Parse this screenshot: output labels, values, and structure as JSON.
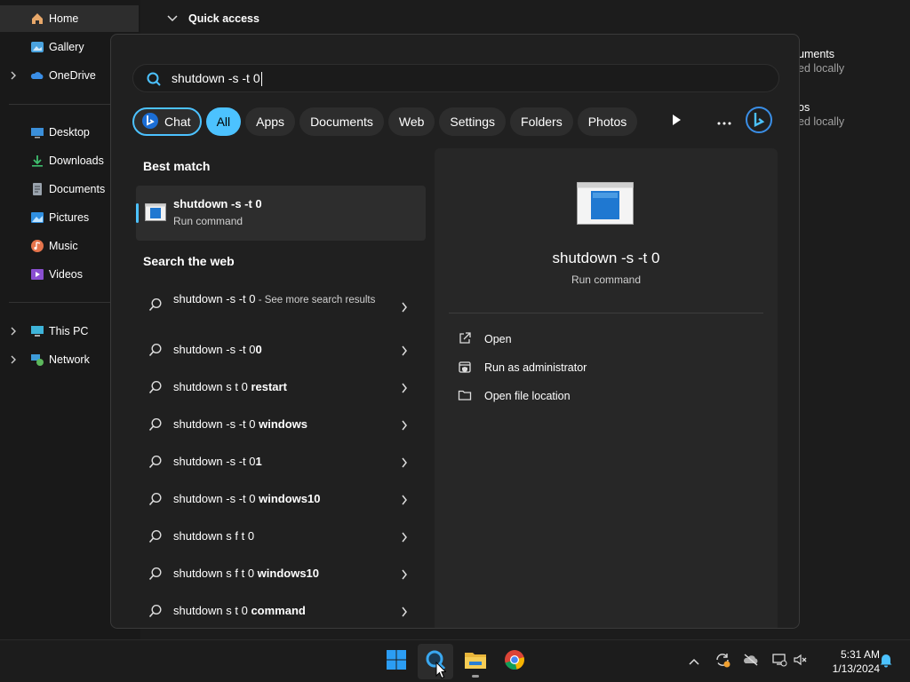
{
  "explorer": {
    "sidebar": [
      {
        "label": "Home",
        "icon": "home-icon"
      },
      {
        "label": "Gallery",
        "icon": "gallery-icon"
      },
      {
        "label": "OneDrive",
        "icon": "onedrive-icon"
      },
      {
        "label": "Desktop",
        "icon": "desktop-icon"
      },
      {
        "label": "Downloads",
        "icon": "downloads-icon"
      },
      {
        "label": "Documents",
        "icon": "documents-icon"
      },
      {
        "label": "Pictures",
        "icon": "pictures-icon"
      },
      {
        "label": "Music",
        "icon": "music-icon"
      },
      {
        "label": "Videos",
        "icon": "videos-icon"
      },
      {
        "label": "This PC",
        "icon": "this-pc-icon"
      },
      {
        "label": "Network",
        "icon": "network-icon"
      }
    ],
    "quick_access": "Quick access",
    "bg_items": [
      {
        "name": "uments",
        "status": "ed locally"
      },
      {
        "name": "os",
        "status": "ed locally"
      }
    ]
  },
  "search": {
    "query": "shutdown -s -t 0",
    "filters": [
      "Chat",
      "All",
      "Apps",
      "Documents",
      "Web",
      "Settings",
      "Folders",
      "Photos"
    ],
    "best_match_title": "Best match",
    "best_match": {
      "title": "shutdown -s -t 0",
      "subtitle": "Run command"
    },
    "web_title": "Search the web",
    "web_first": {
      "text": "shutdown -s -t 0",
      "more": " - See more search results"
    },
    "web_results": [
      {
        "normal": "shutdown -s -t 0",
        "bold": "0"
      },
      {
        "normal": "shutdown s t 0 ",
        "bold": "restart"
      },
      {
        "normal": "shutdown -s -t 0 ",
        "bold": "windows"
      },
      {
        "normal": "shutdown -s -t 0",
        "bold": "1"
      },
      {
        "normal": "shutdown -s -t 0 ",
        "bold": "windows10"
      },
      {
        "normal": "shutdown s f t 0",
        "bold": ""
      },
      {
        "normal": "shutdown s f t 0 ",
        "bold": "windows10"
      },
      {
        "normal": "shutdown s t 0 ",
        "bold": "command"
      }
    ],
    "preview": {
      "title": "shutdown -s -t 0",
      "subtitle": "Run command",
      "actions": [
        {
          "label": "Open",
          "icon": "open-external-icon"
        },
        {
          "label": "Run as administrator",
          "icon": "admin-shield-icon"
        },
        {
          "label": "Open file location",
          "icon": "folder-icon"
        }
      ]
    }
  },
  "taskbar": {
    "apps": [
      "start-icon",
      "search-icon",
      "file-explorer-icon",
      "chrome-icon"
    ],
    "time": "5:31 AM",
    "date": "1/13/2024"
  },
  "colors": {
    "accent": "#4cc2ff",
    "flyout_bg": "#202020",
    "preview_bg": "#272727"
  }
}
